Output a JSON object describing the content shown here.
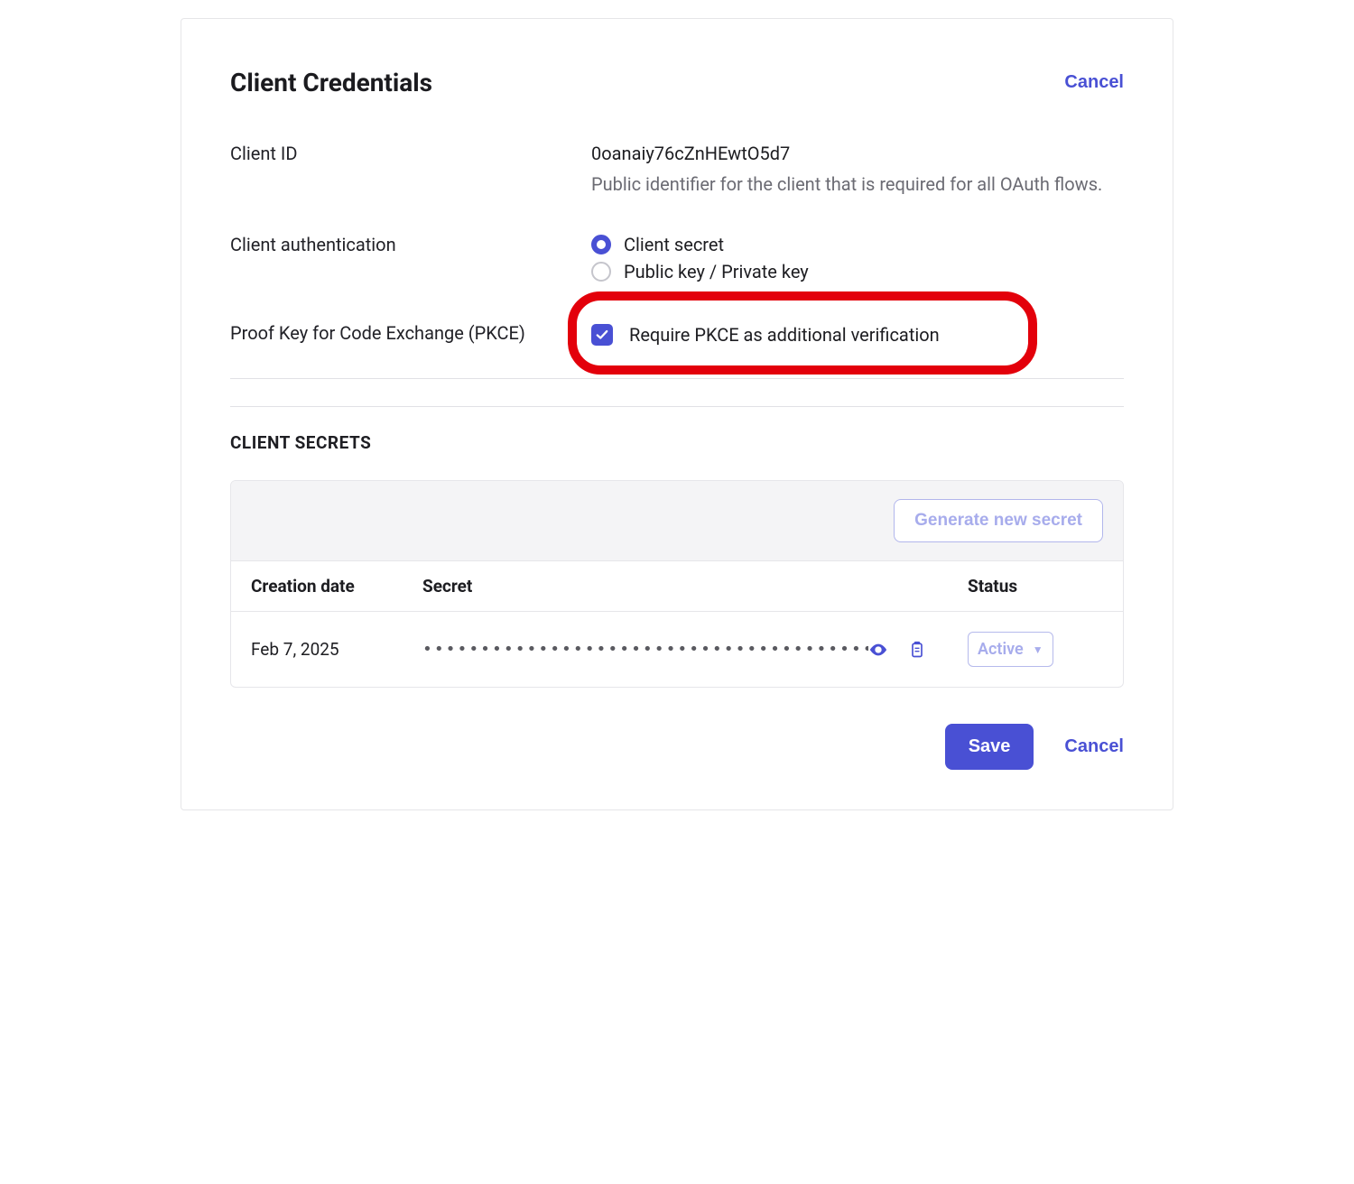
{
  "header": {
    "title": "Client Credentials",
    "cancel_label": "Cancel"
  },
  "client_id": {
    "label": "Client ID",
    "value": "0oanaiy76cZnHEwtO5d7",
    "help": "Public identifier for the client that is required for all OAuth flows."
  },
  "client_auth": {
    "label": "Client authentication",
    "options": [
      {
        "label": "Client secret",
        "selected": true
      },
      {
        "label": "Public key / Private key",
        "selected": false
      }
    ]
  },
  "pkce": {
    "label": "Proof Key for Code Exchange (PKCE)",
    "checkbox_label": "Require PKCE as additional verification",
    "checked": true
  },
  "secrets": {
    "section_title": "CLIENT SECRETS",
    "generate_label": "Generate new secret",
    "columns": {
      "date": "Creation date",
      "secret": "Secret",
      "status": "Status"
    },
    "rows": [
      {
        "date": "Feb 7, 2025",
        "secret_mask": "••••••••••••••••••••••••••••••••••••••••",
        "status": "Active"
      }
    ]
  },
  "footer": {
    "save_label": "Save",
    "cancel_label": "Cancel"
  }
}
